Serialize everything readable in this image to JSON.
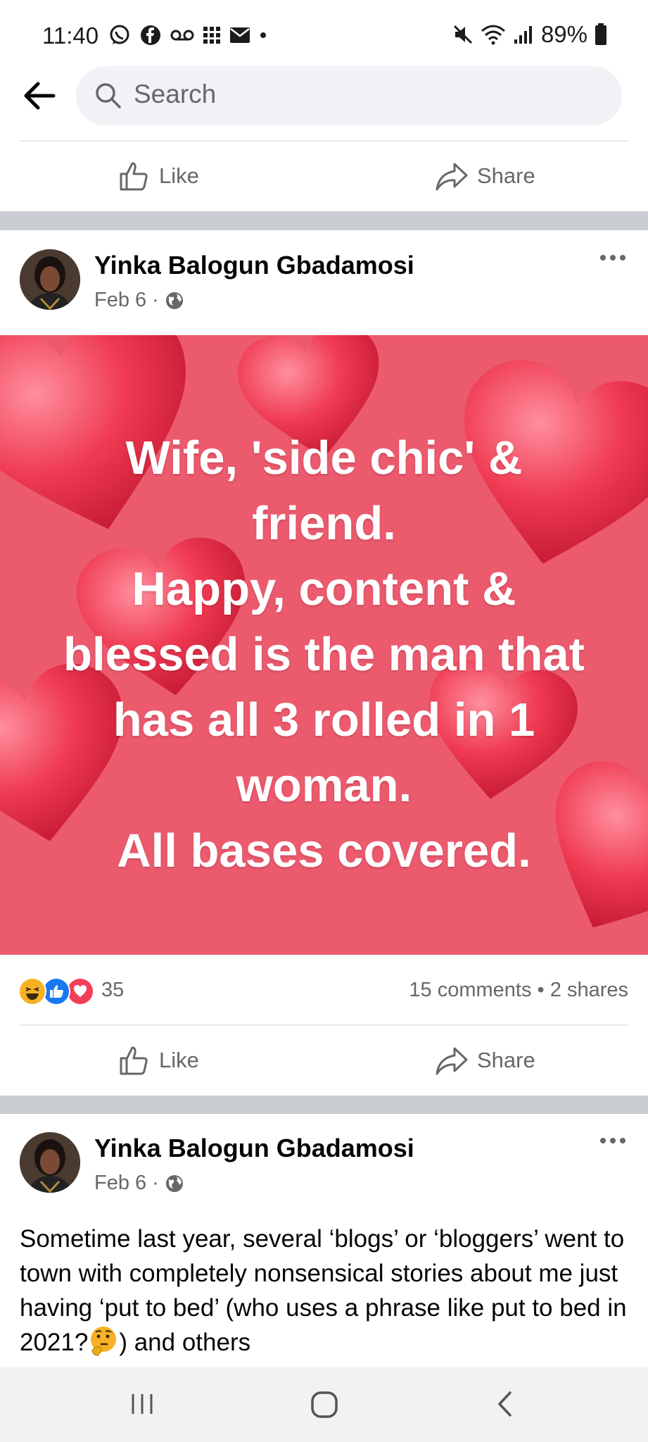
{
  "status_bar": {
    "time": "11:40",
    "battery": "89%"
  },
  "search": {
    "placeholder": "Search"
  },
  "prev_post": {
    "like_label": "Like",
    "share_label": "Share"
  },
  "post1": {
    "author": "Yinka Balogun Gbadamosi",
    "date": "Feb 6",
    "meta_sep": "·",
    "image_text": [
      "Wife, 'side chic' &",
      "friend.",
      "Happy, content &",
      "blessed is the man that",
      "has all 3 rolled in 1",
      "woman.",
      "All bases covered."
    ],
    "reaction_count": "35",
    "comments_shares": "15 comments • 2 shares",
    "like_label": "Like",
    "share_label": "Share"
  },
  "post2": {
    "author": "Yinka Balogun Gbadamosi",
    "date": "Feb 6",
    "meta_sep": "·",
    "text_before_emoji": "Sometime last year, several ‘blogs’ or ‘bloggers’ went to town with completely nonsensical stories about me just having ‘put to bed’ (who uses a phrase like put to bed in 2021?",
    "text_after_emoji": ") and others"
  },
  "icons": [
    "whatsapp-icon",
    "facebook-icon",
    "voicemail-icon",
    "grid-icon",
    "mail-icon",
    "mute-icon",
    "wifi-icon",
    "signal-icon",
    "battery-icon",
    "back-arrow-icon",
    "search-icon",
    "thumbs-up-icon",
    "share-arrow-icon",
    "globe-icon",
    "more-icon",
    "haha-icon",
    "like-reaction-icon",
    "love-reaction-icon",
    "thinking-emoji-icon",
    "recent-apps-icon",
    "home-icon",
    "nav-back-icon"
  ],
  "colors": {
    "brand_blue": "#1877f2",
    "love_red": "#f33e58",
    "haha_yellow": "#f7b125",
    "secondary_text": "#65676b",
    "image_background": "#ec5a6e"
  }
}
